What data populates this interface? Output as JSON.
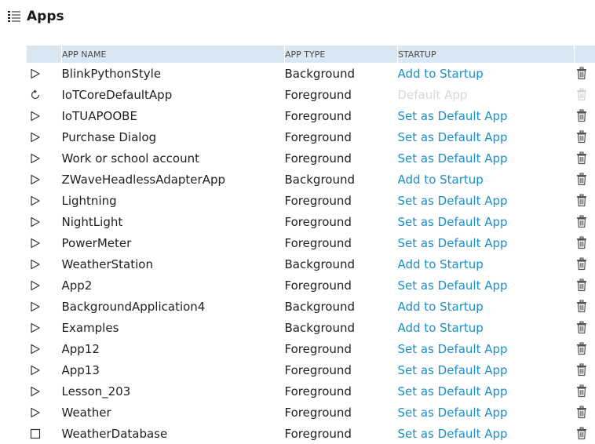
{
  "page": {
    "title": "Apps"
  },
  "table": {
    "columns": {
      "name": "APP NAME",
      "type": "APP TYPE",
      "startup": "STARTUP"
    },
    "rows": [
      {
        "icon": "play-icon",
        "name": "BlinkPythonStyle",
        "type": "Background",
        "startup": "Add to Startup",
        "startup_enabled": true
      },
      {
        "icon": "refresh-icon",
        "name": "IoTCoreDefaultApp",
        "type": "Foreground",
        "startup": "Default App",
        "startup_enabled": false
      },
      {
        "icon": "play-icon",
        "name": "IoTUAPOOBE",
        "type": "Foreground",
        "startup": "Set as Default App",
        "startup_enabled": true
      },
      {
        "icon": "play-icon",
        "name": "Purchase Dialog",
        "type": "Foreground",
        "startup": "Set as Default App",
        "startup_enabled": true
      },
      {
        "icon": "play-icon",
        "name": "Work or school account",
        "type": "Foreground",
        "startup": "Set as Default App",
        "startup_enabled": true
      },
      {
        "icon": "play-icon",
        "name": "ZWaveHeadlessAdapterApp",
        "type": "Background",
        "startup": "Add to Startup",
        "startup_enabled": true
      },
      {
        "icon": "play-icon",
        "name": "Lightning",
        "type": "Foreground",
        "startup": "Set as Default App",
        "startup_enabled": true
      },
      {
        "icon": "play-icon",
        "name": "NightLight",
        "type": "Foreground",
        "startup": "Set as Default App",
        "startup_enabled": true
      },
      {
        "icon": "play-icon",
        "name": "PowerMeter",
        "type": "Foreground",
        "startup": "Set as Default App",
        "startup_enabled": true
      },
      {
        "icon": "play-icon",
        "name": "WeatherStation",
        "type": "Background",
        "startup": "Add to Startup",
        "startup_enabled": true
      },
      {
        "icon": "play-icon",
        "name": "App2",
        "type": "Foreground",
        "startup": "Set as Default App",
        "startup_enabled": true
      },
      {
        "icon": "play-icon",
        "name": "BackgroundApplication4",
        "type": "Background",
        "startup": "Add to Startup",
        "startup_enabled": true
      },
      {
        "icon": "play-icon",
        "name": "Examples",
        "type": "Background",
        "startup": "Add to Startup",
        "startup_enabled": true
      },
      {
        "icon": "play-icon",
        "name": "App12",
        "type": "Foreground",
        "startup": "Set as Default App",
        "startup_enabled": true
      },
      {
        "icon": "play-icon",
        "name": "App13",
        "type": "Foreground",
        "startup": "Set as Default App",
        "startup_enabled": true
      },
      {
        "icon": "play-icon",
        "name": "Lesson_203",
        "type": "Foreground",
        "startup": "Set as Default App",
        "startup_enabled": true
      },
      {
        "icon": "play-icon",
        "name": "Weather",
        "type": "Foreground",
        "startup": "Set as Default App",
        "startup_enabled": true
      },
      {
        "icon": "stop-icon",
        "name": "WeatherDatabase",
        "type": "Foreground",
        "startup": "Set as Default App",
        "startup_enabled": true
      }
    ]
  },
  "colors": {
    "header_bg": "#d9e7f3",
    "link": "#1b8fc9",
    "disabled_link": "#d8d8d8"
  }
}
